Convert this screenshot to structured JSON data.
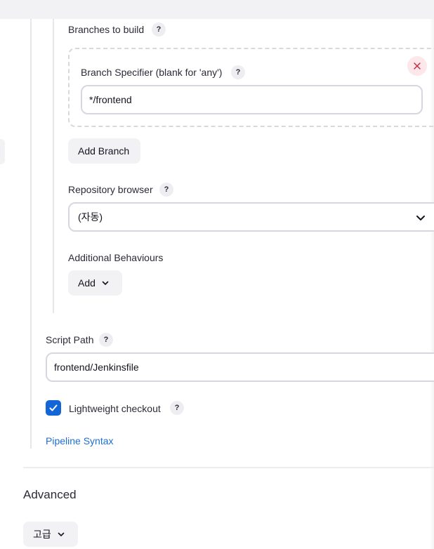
{
  "branches": {
    "label": "Branches to build",
    "specifier_label": "Branch Specifier (blank for 'any')",
    "specifier_value": "*/frontend",
    "add_branch": "Add Branch"
  },
  "repository_browser": {
    "label": "Repository browser",
    "selected": "(자동)"
  },
  "additional_behaviours": {
    "label": "Additional Behaviours",
    "add_button": "Add"
  },
  "script_path": {
    "label": "Script Path",
    "value": "frontend/Jenkinsfile"
  },
  "lightweight": {
    "label": "Lightweight checkout",
    "checked": true
  },
  "pipeline_syntax": "Pipeline Syntax",
  "advanced": {
    "title": "Advanced",
    "button": "고급"
  },
  "help_glyph": "?",
  "colors": {
    "accent": "#1266d8",
    "link": "#1d6fd1",
    "danger": "#c6253b"
  }
}
